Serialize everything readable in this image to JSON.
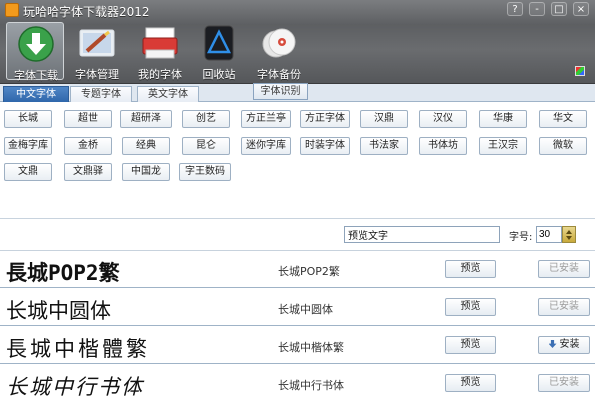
{
  "app": {
    "title": "玩哈哈字体下载器2012",
    "window_buttons": [
      "?",
      "-",
      "□",
      "×"
    ]
  },
  "toolbar": {
    "items": [
      {
        "label": "字体下载",
        "icon": "download-icon",
        "active": true
      },
      {
        "label": "字体管理",
        "icon": "manage-icon",
        "active": false
      },
      {
        "label": "我的字体",
        "icon": "my-fonts-icon",
        "active": false
      },
      {
        "label": "回收站",
        "icon": "recycle-bin-icon",
        "active": false
      },
      {
        "label": "字体备份",
        "icon": "backup-disc-icon",
        "active": false
      }
    ]
  },
  "tabs": {
    "items": [
      {
        "label": "中文字体",
        "active": true
      },
      {
        "label": "专题字体",
        "active": false
      },
      {
        "label": "英文字体",
        "active": false
      }
    ],
    "ocr_label": "字体识别"
  },
  "categories": {
    "rows": [
      [
        "长城",
        "超世",
        "超研泽",
        "创艺",
        "方正兰亭",
        "方正字体",
        "汉鼎",
        "汉仪",
        "华康",
        "华文"
      ],
      [
        "金梅字库",
        "金桥",
        "经典",
        "昆仑",
        "迷你字库",
        "时装字体",
        "书法家",
        "书体坊",
        "王汉宗",
        "微软"
      ],
      [
        "文鼎",
        "文鼎驿",
        "中国龙",
        "字王数码"
      ]
    ]
  },
  "preview": {
    "text": "预览文字",
    "size_label": "字号:",
    "size_value": "30"
  },
  "fonts": [
    {
      "sample": "長城POP2繁",
      "name": "长城POP2繁",
      "preview_label": "预览",
      "install_label": "已安装",
      "installed": true
    },
    {
      "sample": "长城中圆体",
      "name": "长城中圆体",
      "preview_label": "预览",
      "install_label": "已安装",
      "installed": true
    },
    {
      "sample": "長城中楷體繁",
      "name": "长城中楷体繁",
      "preview_label": "预览",
      "install_label": "安装",
      "installed": false
    },
    {
      "sample": "长城中行书体",
      "name": "长城中行书体",
      "preview_label": "预览",
      "install_label": "已安装",
      "installed": true
    }
  ],
  "colors": {
    "toolbar_bg": "#6a6c6f",
    "tab_active": "#2f67ab",
    "row_border": "#9fb3c7"
  }
}
